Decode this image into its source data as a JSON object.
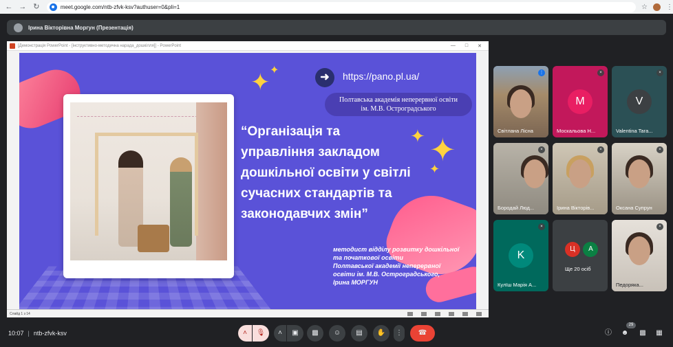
{
  "browser": {
    "url": "meet.google.com/ntb-zfvk-ksv?authuser=0&pli=1"
  },
  "meet": {
    "presenter_bar": "Ірина Вікторівна Моргун (Презентація)",
    "time": "10:07",
    "meeting_code": "ntb-zfvk-ksv",
    "participants_count": "29"
  },
  "ppt": {
    "window_title": "[Демонстрація PowerPoint - [інструктивно-методична нарада_дошкілля]] - PowerPoint",
    "status": "Слайд 1 з 14"
  },
  "slide": {
    "url": "https://pano.pl.ua/",
    "academy_line1": "Полтавська академія неперервної освіти",
    "academy_line2": "ім. М.В. Остроградського",
    "title_lines": [
      "“Організація та",
      "управління закладом",
      "дошкільної освіти у світлі",
      "сучасних стандартів та",
      "законодавчих змін”"
    ],
    "author_lines": [
      "методист відділу розвитку дошкільної",
      "та початкової освіти",
      "Полтавської академії неперервної",
      "освіти ім. М.В. Остроградського,",
      "Ірина МОРГУН"
    ]
  },
  "participants": [
    {
      "name": "Світлана Лісна",
      "type": "video"
    },
    {
      "name": "Москальова Н...",
      "type": "letter",
      "letter": "M",
      "color": "#d81b60"
    },
    {
      "name": "Valentina Tara...",
      "type": "letter",
      "letter": "V",
      "color": "#3c4043"
    },
    {
      "name": "Бородай Люд...",
      "type": "video"
    },
    {
      "name": "Ірина Вікторів...",
      "type": "video"
    },
    {
      "name": "Оксана Супрун",
      "type": "video"
    },
    {
      "name": "Кулїш Марія А...",
      "type": "letter",
      "letter": "K",
      "color": "#00897b"
    },
    {
      "name": "Ще 20 осіб",
      "type": "more",
      "letters": [
        "Ц",
        "A"
      ]
    },
    {
      "name": "Педоряка...",
      "type": "video"
    }
  ],
  "colors": {
    "slide_bg": "#5a52d8",
    "end_call": "#ea4335",
    "meet_bg": "#202124"
  },
  "icons": {
    "controls": [
      "chevron-up-icon",
      "mic-off-icon",
      "camera-icon",
      "present-icon",
      "emoji-icon",
      "captions-icon",
      "raise-hand-icon",
      "more-icon",
      "end-call-icon"
    ],
    "right": [
      "info-icon",
      "people-icon",
      "chat-icon",
      "activities-icon"
    ]
  }
}
